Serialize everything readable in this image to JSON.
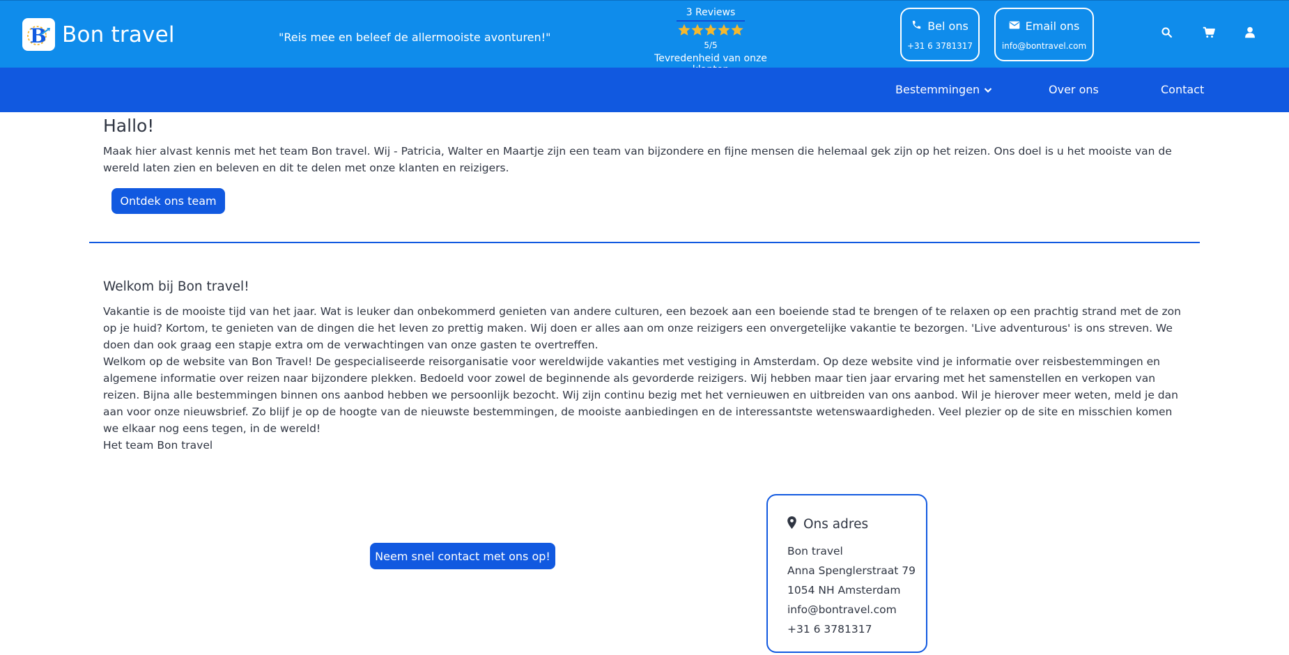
{
  "header": {
    "logo_text": "Bon travel",
    "slogan": "\"Reis mee en beleef de allermooiste avonturen!\"",
    "reviews": {
      "count_label": "3 Reviews",
      "rating": 5,
      "rating_max": 5,
      "score_label": "5/5",
      "satisfaction_label": "Tevredenheid van onze klanten"
    },
    "call": {
      "title": "Bel ons",
      "sub": "+31 6 3781317"
    },
    "email": {
      "title": "Email ons",
      "sub": "info@bontravel.com"
    }
  },
  "nav": {
    "items": [
      {
        "label": "Bestemmingen"
      },
      {
        "label": "Over ons"
      },
      {
        "label": "Contact"
      }
    ]
  },
  "intro": {
    "title": "Hallo!",
    "text": "Maak hier alvast kennis met het team Bon travel. Wij - Patricia, Walter en Maartje zijn een team van bijzondere en fijne mensen die helemaal gek zijn op het reizen. Ons doel is u het mooiste van de wereld laten zien en beleven en dit te delen met onze klanten en reizigers.",
    "button": "Ontdek ons team"
  },
  "welcome": {
    "title": "Welkom bij Bon travel!",
    "paragraph1": "Vakantie is de mooiste tijd van het jaar. Wat is leuker dan onbekommerd genieten van andere culturen, een bezoek aan een boeiende stad te brengen of te relaxen op een prachtig strand met de zon op je huid? Kortom, te genieten van de dingen die het leven zo prettig maken. Wij doen er alles aan om onze reizigers een onvergetelijke vakantie te bezorgen. 'Live adventurous' is ons streven. We doen dan ook graag een stapje extra om de verwachtingen van onze gasten te overtreffen.",
    "paragraph2": "Welkom op de website van Bon Travel! De gespecialiseerde reisorganisatie voor wereldwijde vakanties met vestiging in Amsterdam. Op deze website vind je informatie over reisbestemmingen en algemene informatie over reizen naar bijzondere plekken. Bedoeld voor zowel de beginnende als gevorderde reizigers. Wij hebben maar tien jaar ervaring met het samenstellen en verkopen van reizen. Bijna alle bestemmingen binnen ons aanbod hebben we persoonlijk bezocht. Wij zijn continu bezig met het vernieuwen en uitbreiden van ons aanbod. Wil je hierover meer weten, meld je dan aan voor onze nieuwsbrief. Zo blijf je op de hoogte van de nieuwste bestemmingen, de mooiste aanbiedingen en de interessantste wetenswaardigheden. Veel plezier op de site en misschien komen we elkaar nog eens tegen, in de wereld!",
    "signature": "Het team Bon travel"
  },
  "contact_cta": "Neem snel contact met ons op!",
  "address": {
    "title": "Ons adres",
    "name": "Bon travel",
    "street": "Anna Spenglerstraat 79",
    "city": "1054 NH Amsterdam",
    "email": "info@bontravel.com",
    "phone": "+31 6 3781317"
  },
  "colors": {
    "header_bg": "#0f8ceb",
    "nav_bg": "#1159e0",
    "accent": "#1159e0",
    "star": "#f5b82e",
    "text": "#2f3542"
  },
  "icons": [
    "logo-b-icon",
    "phone-icon",
    "envelope-icon",
    "search-icon",
    "cart-icon",
    "user-icon",
    "chevron-down-icon",
    "map-pin-icon",
    "star-icon"
  ]
}
